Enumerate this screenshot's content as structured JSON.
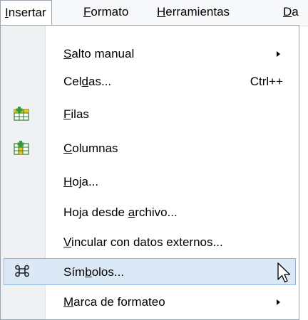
{
  "menubar": {
    "items": [
      {
        "pre": "",
        "u": "I",
        "post": "nsertar",
        "active": true
      },
      {
        "pre": "",
        "u": "F",
        "post": "ormato",
        "active": false
      },
      {
        "pre": "",
        "u": "H",
        "post": "erramientas",
        "active": false
      },
      {
        "pre": "",
        "u": "D",
        "post": "a",
        "active": false
      }
    ]
  },
  "menu": {
    "items": [
      {
        "pre": "",
        "u": "S",
        "post": "alto manual",
        "shortcut": "",
        "submenu": true,
        "icon": ""
      },
      {
        "pre": "Cel",
        "u": "d",
        "post": "as...",
        "shortcut": "Ctrl++",
        "submenu": false,
        "icon": ""
      },
      {
        "pre": "",
        "u": "F",
        "post": "ilas",
        "shortcut": "",
        "submenu": false,
        "icon": "insert-rows-icon"
      },
      {
        "pre": "",
        "u": "C",
        "post": "olumnas",
        "shortcut": "",
        "submenu": false,
        "icon": "insert-columns-icon"
      },
      {
        "pre": "",
        "u": "H",
        "post": "oja...",
        "shortcut": "",
        "submenu": false,
        "icon": ""
      },
      {
        "pre": "Hoja desde ",
        "u": "a",
        "post": "rchivo...",
        "shortcut": "",
        "submenu": false,
        "icon": ""
      },
      {
        "pre": "",
        "u": "V",
        "post": "incular con datos externos...",
        "shortcut": "",
        "submenu": false,
        "icon": ""
      },
      {
        "pre": "Sím",
        "u": "b",
        "post": "olos...",
        "shortcut": "",
        "submenu": false,
        "icon": "command-symbol-icon",
        "highlighted": true
      },
      {
        "pre": "",
        "u": "M",
        "post": "arca de formateo",
        "shortcut": "",
        "submenu": true,
        "icon": ""
      }
    ]
  },
  "colors": {
    "highlight_bg": "#dbe8f6",
    "highlight_border": "#8fb3de",
    "icon_green": "#2e9e3a",
    "icon_yellow": "#e8c21a"
  }
}
